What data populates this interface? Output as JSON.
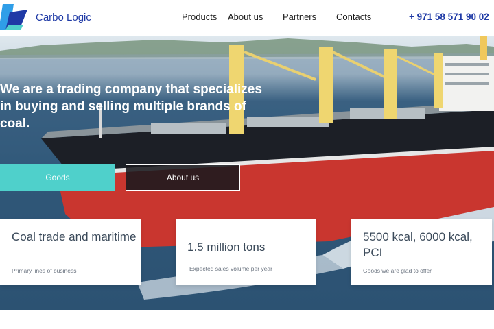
{
  "brand": {
    "name": "Carbo Logic"
  },
  "nav": {
    "items": [
      "Products",
      "About us",
      "Partners",
      "Contacts"
    ]
  },
  "contact": {
    "phone": "+ 971 58 571 90 02"
  },
  "hero": {
    "headline": "We are a trading company that specializes in buying and selling multiple brands of coal.",
    "buttons": {
      "goods": "Goods",
      "about": "About us"
    }
  },
  "cards": [
    {
      "title": "Coal trade and maritime",
      "subtitle": "Primary lines of business"
    },
    {
      "title": "1.5 million tons",
      "subtitle": "Expected sales volume per year"
    },
    {
      "title": "5500 kcal, 6000 kcal, PCI",
      "subtitle": "Goods we are glad to offer"
    }
  ],
  "colors": {
    "brand_blue": "#1f3aa6",
    "accent_teal": "#4fd0cb",
    "ship_red": "#c9362f",
    "ship_hull": "#1c1f26"
  },
  "icons": {
    "logo": "carbo-logic-logo"
  }
}
